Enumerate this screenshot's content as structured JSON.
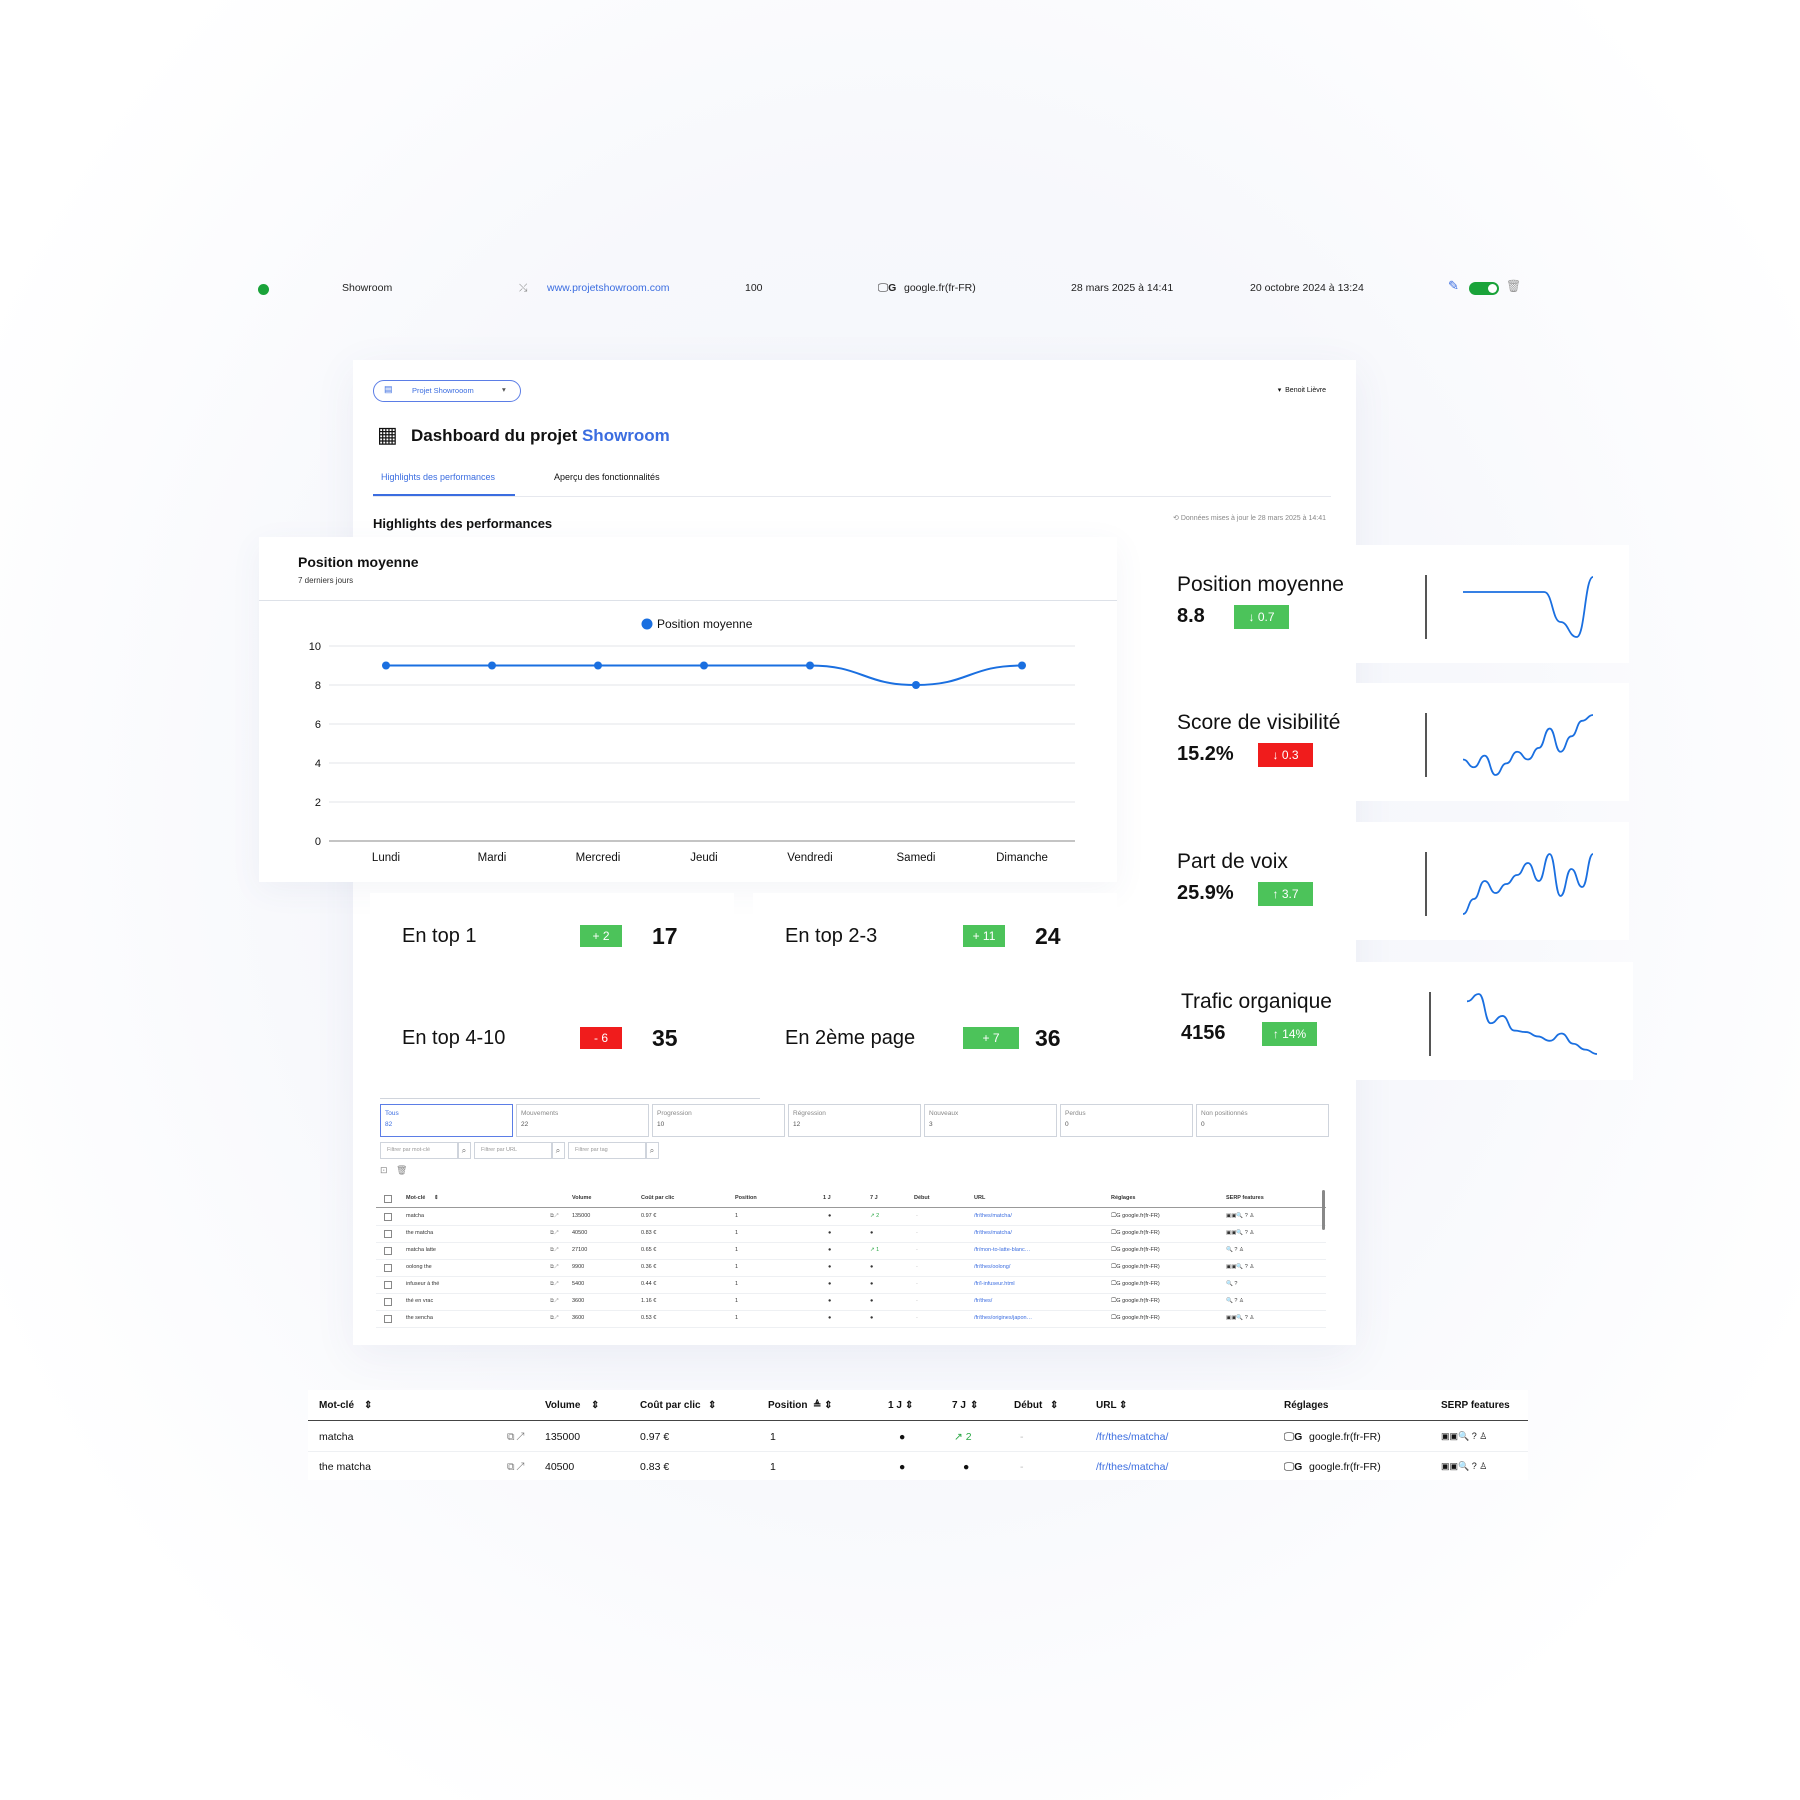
{
  "project_row": {
    "name": "Showroom",
    "url": "www.projetshowroom.com",
    "count": "100",
    "engine": "google.fr(fr-FR)",
    "updated": "28 mars 2025 à 14:41",
    "created": "20 octobre 2024 à 13:24"
  },
  "dashboard": {
    "project_select": "Projet Showrooom",
    "user": "Benoit Lièvre",
    "title_prefix": "Dashboard du projet",
    "title_project": "Showroom",
    "tabs": [
      "Highlights des performances",
      "Aperçu des fonctionnalités"
    ],
    "section_title": "Highlights des performances",
    "updated_note": "Données mises à jour le 28 mars 2025 à 14:41"
  },
  "chart_card": {
    "title": "Position moyenne",
    "subtitle": "7 derniers jours"
  },
  "chart_data": {
    "type": "line",
    "categories": [
      "Lundi",
      "Mardi",
      "Mercredi",
      "Jeudi",
      "Vendredi",
      "Samedi",
      "Dimanche"
    ],
    "series": [
      {
        "name": "Position moyenne",
        "values": [
          9,
          9,
          9,
          9,
          9,
          8,
          9
        ]
      }
    ],
    "yticks": [
      "0",
      "2",
      "4",
      "6",
      "8",
      "10"
    ],
    "ylim": [
      0,
      10
    ],
    "grid": true,
    "legend": "top-center",
    "color": "#1a6fe0"
  },
  "metrics": [
    {
      "label": "Position moyenne",
      "value": "8.8",
      "delta": "↓ 0.7",
      "trend": "up",
      "spark": [
        5,
        5,
        5,
        5,
        5,
        5,
        4.6,
        4.4,
        5.2
      ]
    },
    {
      "label": "Score de visibilité",
      "value": "15.2%",
      "delta": "↓ 0.3",
      "trend": "down",
      "spark": [
        3,
        2.6,
        3.2,
        2.2,
        2.8,
        3.4,
        3,
        3.6,
        4.6,
        3.4,
        4.2,
        5,
        5.3
      ]
    },
    {
      "label": "Part de voix",
      "value": "25.9%",
      "delta": "↑ 3.7",
      "trend": "up",
      "spark": [
        2,
        3,
        4.2,
        3.4,
        4,
        4.6,
        5.4,
        4.2,
        6,
        3.2,
        5,
        3.8,
        6
      ]
    },
    {
      "label": "Trafic organique",
      "value": "4156",
      "delta": "↑ 14%",
      "trend": "up",
      "spark": [
        8,
        9,
        5,
        6,
        4,
        3.8,
        3.2,
        2.6,
        3.6,
        2.2,
        1.4,
        0.8
      ]
    }
  ],
  "ranks": [
    {
      "label": "En top 1",
      "delta": "+ 2",
      "trend": "up",
      "value": "17"
    },
    {
      "label": "En top 2-3",
      "delta": "+ 11",
      "trend": "up",
      "value": "24"
    },
    {
      "label": "En top 4-10",
      "delta": "- 6",
      "trend": "down",
      "value": "35"
    },
    {
      "label": "En 2ème page",
      "delta": "+ 7",
      "trend": "up",
      "value": "36"
    }
  ],
  "filters": [
    {
      "label": "Tous",
      "value": "82"
    },
    {
      "label": "Mouvements",
      "value": "22"
    },
    {
      "label": "Progression",
      "value": "10"
    },
    {
      "label": "Régression",
      "value": "12"
    },
    {
      "label": "Nouveaux",
      "value": "3"
    },
    {
      "label": "Perdus",
      "value": "0"
    },
    {
      "label": "Non positionnés",
      "value": "0"
    }
  ],
  "search": {
    "keyword": "Filtrer par mot-clé",
    "url": "Filtrer par URL",
    "tag": "Filtrer par tag"
  },
  "table": {
    "headers": [
      "Mot-clé",
      "Volume",
      "Coût par clic",
      "Position",
      "1 J",
      "7 J",
      "Début",
      "URL",
      "Réglages",
      "SERP features"
    ],
    "engine": "google.fr(fr-FR)",
    "rows": [
      {
        "kw": "matcha",
        "vol": "135000",
        "cpc": "0.97 €",
        "pos": "1",
        "d1": "●",
        "d7": "↗ 2",
        "start": "-",
        "url": "/fr/thes/matcha/",
        "serp": "▣▣🔍 ? ♙"
      },
      {
        "kw": "the matcha",
        "vol": "40500",
        "cpc": "0.83 €",
        "pos": "1",
        "d1": "●",
        "d7": "●",
        "start": "-",
        "url": "/fr/thes/matcha/",
        "serp": "▣▣🔍 ? ♙"
      },
      {
        "kw": "matcha latte",
        "vol": "27100",
        "cpc": "0.65 €",
        "pos": "1",
        "d1": "●",
        "d7": "↗ 1",
        "start": "-",
        "url": "/fr/mon-to-latte-blanc…",
        "serp": "🔍 ? ♙"
      },
      {
        "kw": "oolong the",
        "vol": "9900",
        "cpc": "0.36 €",
        "pos": "1",
        "d1": "●",
        "d7": "●",
        "start": "-",
        "url": "/fr/thes/oolong/",
        "serp": "▣▣🔍 ? ♙"
      },
      {
        "kw": "infuseur à thé",
        "vol": "5400",
        "cpc": "0.44 €",
        "pos": "1",
        "d1": "●",
        "d7": "●",
        "start": "-",
        "url": "/fr/l-infuseur.html",
        "serp": "🔍 ?"
      },
      {
        "kw": "thé en vrac",
        "vol": "3600",
        "cpc": "1.16 €",
        "pos": "1",
        "d1": "●",
        "d7": "●",
        "start": "-",
        "url": "/fr/thes/",
        "serp": "🔍 ? ♙"
      },
      {
        "kw": "the sencha",
        "vol": "3600",
        "cpc": "0.53 €",
        "pos": "1",
        "d1": "●",
        "d7": "●",
        "start": "-",
        "url": "/fr/thes/origines/japon…",
        "serp": "▣▣🔍 ? ♙"
      }
    ]
  }
}
